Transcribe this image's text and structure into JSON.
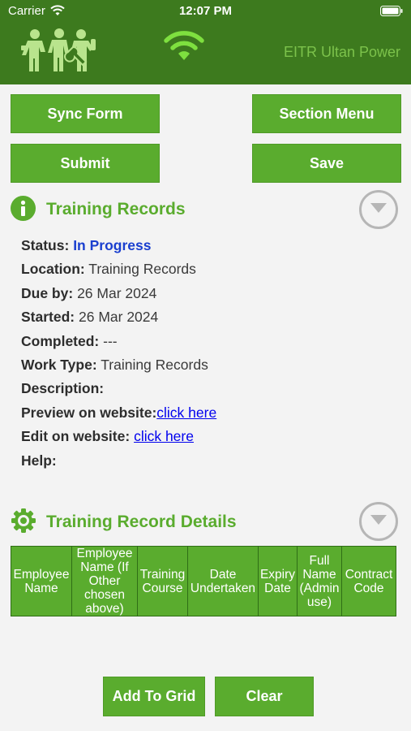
{
  "status_bar": {
    "carrier": "Carrier",
    "time": "12:07 PM"
  },
  "header": {
    "app_title": "EITR Ultan Power",
    "logo_icon": "workers-logo-icon",
    "signal_icon": "wifi-signal-icon"
  },
  "actions": {
    "sync_form": "Sync Form",
    "section_menu": "Section Menu",
    "submit": "Submit",
    "save": "Save"
  },
  "training_records": {
    "title": "Training Records",
    "status_label": "Status:",
    "status_value": "In Progress",
    "location_label": "Location:",
    "location_value": "Training Records",
    "due_label": "Due by:",
    "due_value": "26 Mar 2024",
    "started_label": "Started:",
    "started_value": "26 Mar 2024",
    "completed_label": "Completed:",
    "completed_value": "---",
    "work_type_label": "Work Type:",
    "work_type_value": "Training Records",
    "description_label": "Description:",
    "preview_label": "Preview on website:",
    "preview_link": "click here",
    "edit_label": "Edit on website:",
    "edit_link": "click here",
    "help_label": "Help:"
  },
  "details": {
    "title": "Training Record Details",
    "columns": [
      "Employee Name",
      "Employee Name (If Other chosen above)",
      "Training Course",
      "Date Undertaken",
      "Expiry Date",
      "Full Name (Admin use)",
      "Contract Code"
    ]
  },
  "bottom_actions": {
    "add_to_grid": "Add To Grid",
    "clear": "Clear"
  },
  "colors": {
    "header_green": "#3d7a1e",
    "accent_green": "#5aac2e",
    "status_blue": "#1a3fcf"
  }
}
